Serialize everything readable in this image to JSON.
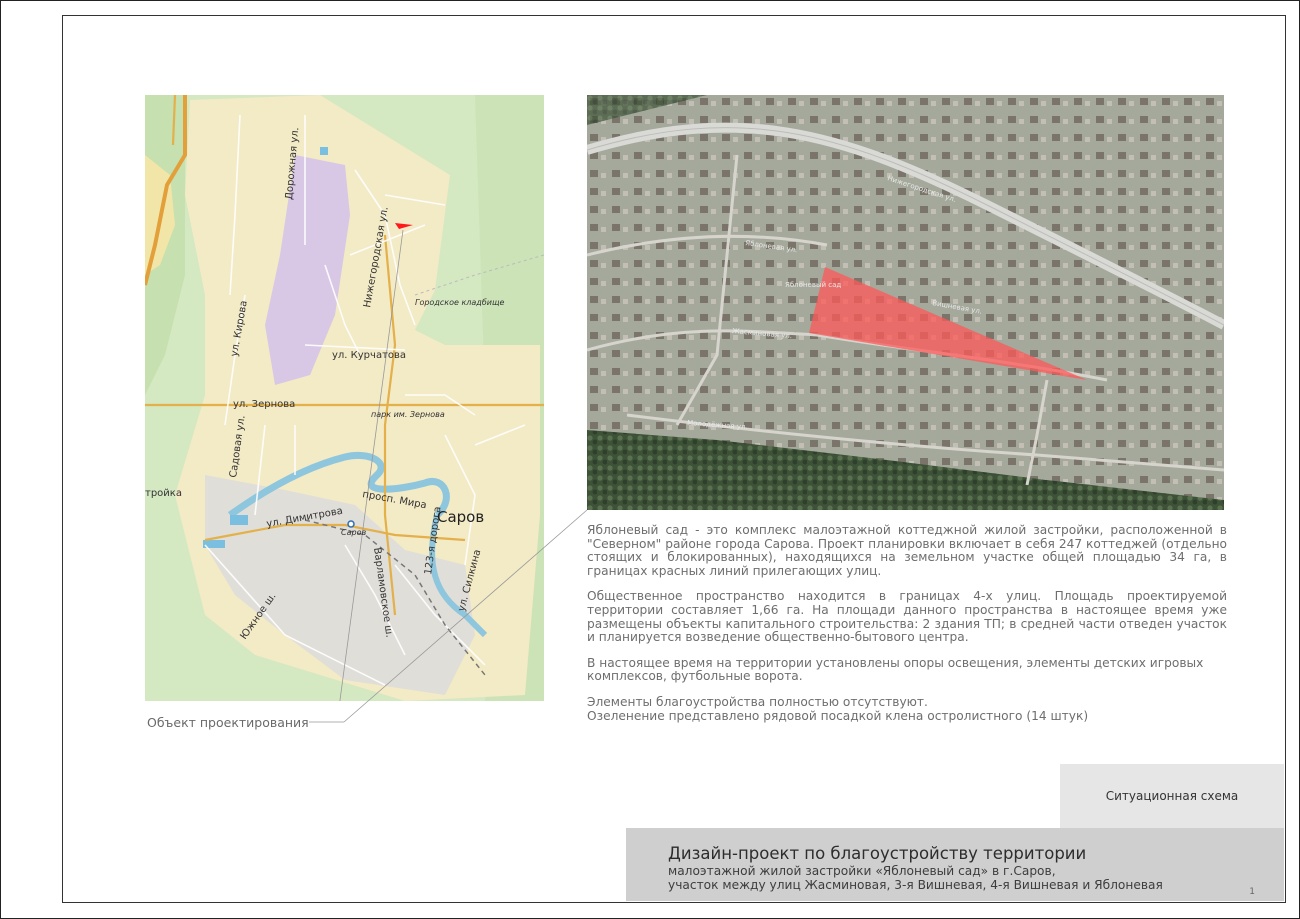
{
  "city_map": {
    "streets": [
      "Дорожная ул.",
      "Нижегородская ул.",
      "ул. Кирова",
      "ул. Курчатова",
      "ул. Зернова",
      "Садовая ул.",
      "ул. Димитрова",
      "просп. Мира",
      "123-я дорога",
      "Варламовское ш.",
      "ул. Силкина",
      "Южное ш."
    ],
    "places": {
      "cemetery": "Городское кладбище",
      "park": "парк им. Зернова",
      "city": "Саров",
      "station": "Саров",
      "edge_fragment": "тройка"
    },
    "target_color": "#ff1a1a"
  },
  "aerial": {
    "street_labels": [
      "Нижегородская ул.",
      "Яблоневая ул.",
      "Жасминовая ул.",
      "Яблоневый сад",
      "Вишневая ул.",
      "Молодёжная ул."
    ],
    "highlight_color": "#ff5a5a"
  },
  "object_label": "Объект проектирования",
  "description": {
    "p1": "Яблоневый сад - это комплекс малоэтажной коттеджной жилой застройки, расположенной в \"Северном\" районе города Сарова. Проект планировки включает в себя 247 коттеджей (отдельно стоящих и блокированных), находящихся на земельном участке общей площадью 34 га, в границах красных линий прилегающих улиц.",
    "p2": "Общественное пространство находится в границах 4-х улиц. Площадь проектируемой территории составляет 1,66 га. На площади данного пространства в настоящее время уже размещены объекты капитального строительства: 2 здания ТП; в средней части отведен участок и планируется возведение общественно-бытового центра.",
    "p3": "В настоящее время на территории установлены опоры освещения, элементы детских игровых комплексов, футбольные ворота.",
    "p4_line1": "Элементы благоустройства полностью отсутствуют.",
    "p4_line2": "Озеленение представлено рядовой посадкой клена остролистного (14 штук)"
  },
  "situation_label": "Ситуационная схема",
  "title_block": {
    "main": "Дизайн-проект по благоустройству территории",
    "sub1": "малоэтажной жилой застройки «Яблоневый сад» в г.Саров,",
    "sub2": "участок между улиц Жасминовая, 3-я Вишневая, 4-я Вишневая и Яблоневая",
    "page": "1"
  }
}
